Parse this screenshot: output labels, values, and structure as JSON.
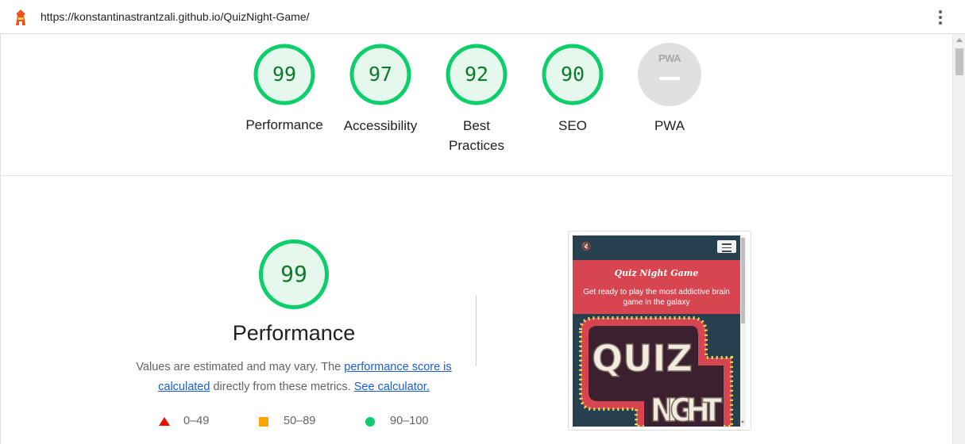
{
  "urlbar": {
    "url": "https://konstantinastrantzali.github.io/QuizNight-Game/",
    "logo_icon": "lighthouse-icon",
    "menu_icon": "kebab-menu-icon"
  },
  "categories": [
    {
      "score": "99",
      "label": "Performance"
    },
    {
      "score": "97",
      "label": "Accessibility"
    },
    {
      "score": "92",
      "label": "Best Practices"
    },
    {
      "score": "90",
      "label": "SEO"
    },
    {
      "score": "",
      "label": "PWA",
      "badge": "PWA"
    }
  ],
  "performance": {
    "score": "99",
    "title": "Performance",
    "desc_prefix": "Values are estimated and may vary. The ",
    "link_score": "performance score is calculated",
    "desc_middle": " directly from these metrics. ",
    "link_calc": "See calculator.",
    "legend": [
      {
        "icon": "red-triangle-icon",
        "range": "0–49"
      },
      {
        "icon": "orange-square-icon",
        "range": "50–89"
      },
      {
        "icon": "green-circle-icon",
        "range": "90–100"
      }
    ]
  },
  "screenshot": {
    "title": "Quiz Night Game",
    "subtitle": "Get ready to play the most addictive brain game in the galaxy",
    "logo_text_1": "QUIZ",
    "logo_text_2": "NIGHT"
  },
  "colors": {
    "pass": "#0cce6b",
    "pass_text": "#0c7a2c",
    "pass_fill": "#e6f8ed",
    "average": "#ffa400",
    "fail": "#eb0f00",
    "na": "#e0e0e0"
  }
}
